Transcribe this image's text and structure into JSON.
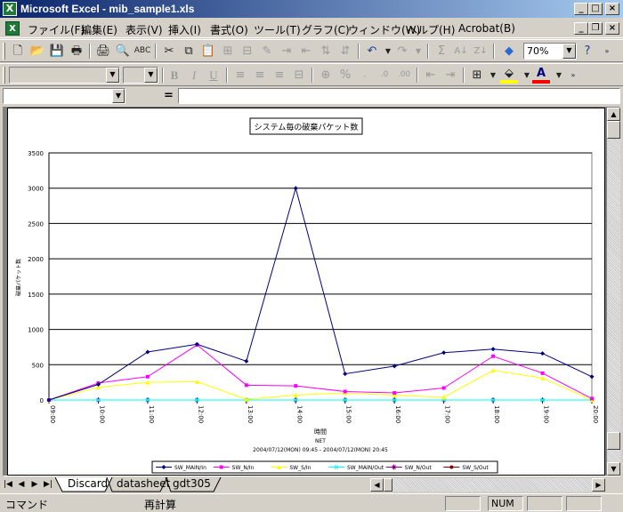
{
  "window": {
    "title": "Microsoft Excel - mib_sample1.xls",
    "minimize": "_",
    "maximize": "□",
    "close": "×"
  },
  "menu": {
    "items": [
      "ファイル(F)",
      "編集(E)",
      "表示(V)",
      "挿入(I)",
      "書式(O)",
      "ツール(T)",
      "グラフ(C)",
      "ウィンドウ(W)",
      "ヘルプ(H)",
      "Acrobat(B)"
    ]
  },
  "toolbar": {
    "zoom": "70%"
  },
  "formula_bar": {
    "name_box": "",
    "equals": "=",
    "content": ""
  },
  "sheet_tabs": {
    "nav": [
      "|◀",
      "◀",
      "▶",
      "▶|"
    ],
    "tabs": [
      "Discard",
      "datasheet",
      "gdt305"
    ],
    "active": "Discard"
  },
  "status_bar": {
    "mode": "コマンド",
    "calc": "再計算",
    "num": "NUM"
  },
  "chart_data": {
    "type": "line",
    "title": "システム毎の破棄パケット数",
    "xlabel": "時間",
    "xlabel_sub": "NET",
    "xlabel_range": "2004/07/12(MON) 09:45 - 2004/07/12(MON) 20:45",
    "ylabel": "破棄パケット数",
    "ylim": [
      0,
      3500
    ],
    "yticks": [
      "0",
      "500",
      "1000",
      "1500",
      "2000",
      "2500",
      "3000",
      "3500"
    ],
    "grid": true,
    "legend_position": "bottom",
    "categories": [
      "09:00",
      "10:00",
      "11:00",
      "12:00",
      "13:00",
      "14:00",
      "15:00",
      "16:00",
      "17:00",
      "18:00",
      "19:00",
      "20:00"
    ],
    "series": [
      {
        "name": "SW_MAIN/In",
        "color": "#000080",
        "marker": "diamond",
        "values": [
          0,
          220,
          680,
          790,
          550,
          3000,
          370,
          480,
          670,
          720,
          660,
          330
        ]
      },
      {
        "name": "SW_N/In",
        "color": "#ff00ff",
        "marker": "square",
        "values": [
          0,
          240,
          330,
          780,
          210,
          200,
          120,
          100,
          170,
          620,
          380,
          20
        ]
      },
      {
        "name": "SW_S/In",
        "color": "#ffff00",
        "marker": "triangle",
        "values": [
          0,
          180,
          250,
          260,
          10,
          70,
          100,
          70,
          40,
          420,
          310,
          0
        ]
      },
      {
        "name": "SW_MAIN/Out",
        "color": "#00ffff",
        "marker": "x",
        "values": [
          0,
          0,
          0,
          0,
          0,
          0,
          0,
          0,
          0,
          0,
          0,
          0
        ]
      },
      {
        "name": "SW_N/Out",
        "color": "#800080",
        "marker": "star",
        "values": [
          0,
          0,
          0,
          0,
          0,
          0,
          0,
          0,
          0,
          0,
          0,
          0
        ]
      },
      {
        "name": "SW_S/Out",
        "color": "#800000",
        "marker": "circle",
        "values": [
          0,
          0,
          0,
          0,
          0,
          0,
          0,
          0,
          0,
          0,
          0,
          0
        ]
      }
    ]
  }
}
